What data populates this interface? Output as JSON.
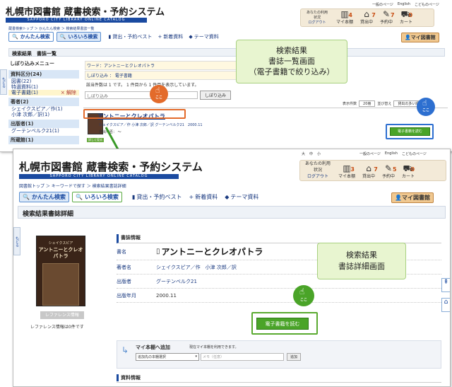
{
  "screen1": {
    "logo": "札幌市図書館 蔵書検索・予約システム",
    "logo_sub": "SAPPORO CITY LIBRARY ONLINE CATALOG",
    "top_links": [
      "一般のページ",
      "English",
      "こどものページ"
    ],
    "user": {
      "label": "あなたの利用状況",
      "logout": "ログアウト"
    },
    "stats": [
      {
        "label": "マイ本棚",
        "count": "4"
      },
      {
        "label": "貸出中",
        "count": "7"
      },
      {
        "label": "予約中",
        "count": "7"
      },
      {
        "label": "カート",
        "count": "0"
      }
    ],
    "breadcrumb": "蔵書検索トップ ＞ かんたん検索 ＞ 検索結果書誌一覧",
    "tabs": [
      "かんたん検索",
      "いろいろ検索"
    ],
    "nav": [
      "貸出・予約ベスト",
      "新着資料",
      "テーマ資料"
    ],
    "mylib": "マイ図書館",
    "section_title": "検索結果　書誌一覧",
    "sidebar_title": "しぼり込みメニュー",
    "side_groups": [
      {
        "head": "資料区分(24)",
        "items": [
          "図書(22)",
          "特選資料(1)"
        ],
        "active": "電子書籍(1)",
        "active_remove": "× 解除"
      },
      {
        "head": "著者(2)",
        "items": [
          "シェイクスピア／作(1)",
          "小津 次郎／訳(1)"
        ]
      },
      {
        "head": "出版者(1)",
        "items": [
          "グーテンベルク21(1)"
        ]
      },
      {
        "head": "所蔵館(1)",
        "items": []
      }
    ],
    "filter": {
      "word": "ワード：アントニーとクレオパトラ",
      "narrow": "しぼり込み ： 電子書籍",
      "count": "該当件数は 1 です。 1 件目から 1 件目を表示しています。",
      "label": "しぼり込み",
      "button": "しぼり込み"
    },
    "display": {
      "count_label": "表示件数",
      "count_val": "20冊",
      "sort_label": "並び替え",
      "sort_val": "貸出の多い順"
    },
    "result": {
      "title": "アントニーとクレオパトラ",
      "meta": "シェイクスピア／作 小津 次郎／訳 グーテンベルク21　2000.11",
      "status": "貸出可否： ～",
      "thumb_btn": "詳しく見る",
      "read_btn": "電子書籍を読む"
    },
    "note": [
      "検索結果",
      "書誌一覧画面",
      "（電子書籍で絞り込み）"
    ],
    "koko": "ここ",
    "back_tab": "もどる"
  },
  "screen2": {
    "font_size": [
      "大",
      "中",
      "小"
    ],
    "top_links": [
      "一般のページ",
      "English",
      "こどものページ"
    ],
    "logo": "札幌市図書館 蔵書検索・予約システム",
    "logo_sub": "SAPPORO CITY LIBRARY ONLINE CATALOG",
    "user": {
      "label": "あなたの利用状況",
      "logout": "ログアウト"
    },
    "stats": [
      {
        "label": "マイ本棚",
        "count": "3"
      },
      {
        "label": "貸出中",
        "count": "7"
      },
      {
        "label": "予約中",
        "count": "5"
      },
      {
        "label": "カート",
        "count": "0"
      }
    ],
    "breadcrumb": "図書館トップ ＞ キーワードで探す ＞ 検索結果書誌詳細",
    "tabs": [
      "かんたん検索",
      "いろいろ検索"
    ],
    "nav": [
      "貸出・予約ベスト",
      "新着資料",
      "テーマ資料"
    ],
    "mylib": "マイ図書館",
    "section_title": "検索結果書誌詳細",
    "cover": {
      "author": "シェイクスピア",
      "title": "アントニーとクレオパトラ"
    },
    "ref_btn": "レファレンス情報",
    "ref_info": "レファレンス情報は0件です",
    "biblio_title": "書誌情報",
    "fields": [
      {
        "key": "書名",
        "value": "アントニーとクレオパトラ"
      },
      {
        "key": "著者名",
        "value": "シェイクスピア／作　小津 次郎／訳"
      },
      {
        "key": "出版者",
        "value": "グーテンベルク21"
      },
      {
        "key": "出版年月",
        "value": "2000.11"
      }
    ],
    "read_btn": "電子書籍を読む",
    "shelf": {
      "title": "マイ本棚へ追加",
      "current": "現在マイ本棚を利用できます。",
      "select": "追加先の本棚選択",
      "memo_placeholder": "メモ（任意）",
      "add": "追加"
    },
    "material_title": "資料情報",
    "note": [
      "検索結果",
      "書誌詳細画面"
    ],
    "koko": "ここ",
    "back_tab": "もどる"
  }
}
